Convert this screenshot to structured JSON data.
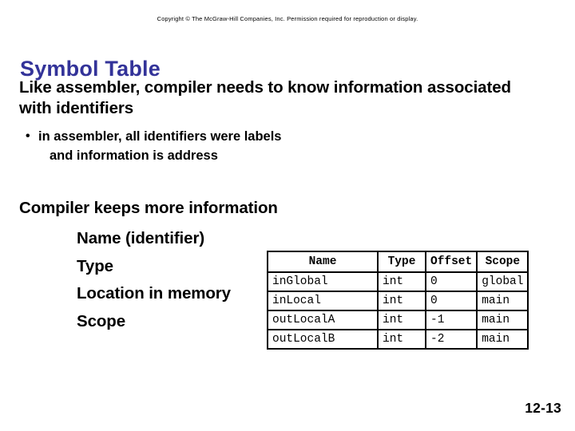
{
  "slide": {
    "copyright": "Copyright © The McGraw-Hill Companies, Inc. Permission required for reproduction or display.",
    "title": "Symbol Table",
    "title_color": "#333399",
    "lead_paragraph": "Like assembler, compiler needs to know information associated with identifiers",
    "bullet": {
      "marker": "•",
      "line1": "in assembler, all identifiers were labels",
      "line2": "and information is address"
    },
    "section2": {
      "heading": "Compiler keeps more information",
      "items": [
        "Name (identifier)",
        "Type",
        "Location in memory",
        "Scope"
      ]
    },
    "page_number": "12-13"
  },
  "symbol_table": {
    "headers": [
      "Name",
      "Type",
      "Offset",
      "Scope"
    ],
    "rows": [
      {
        "name": "inGlobal",
        "type": "int",
        "offset": "0",
        "scope": "global"
      },
      {
        "name": "inLocal",
        "type": "int",
        "offset": "0",
        "scope": "main"
      },
      {
        "name": "outLocalA",
        "type": "int",
        "offset": "-1",
        "scope": "main"
      },
      {
        "name": "outLocalB",
        "type": "int",
        "offset": "-2",
        "scope": "main"
      }
    ]
  }
}
